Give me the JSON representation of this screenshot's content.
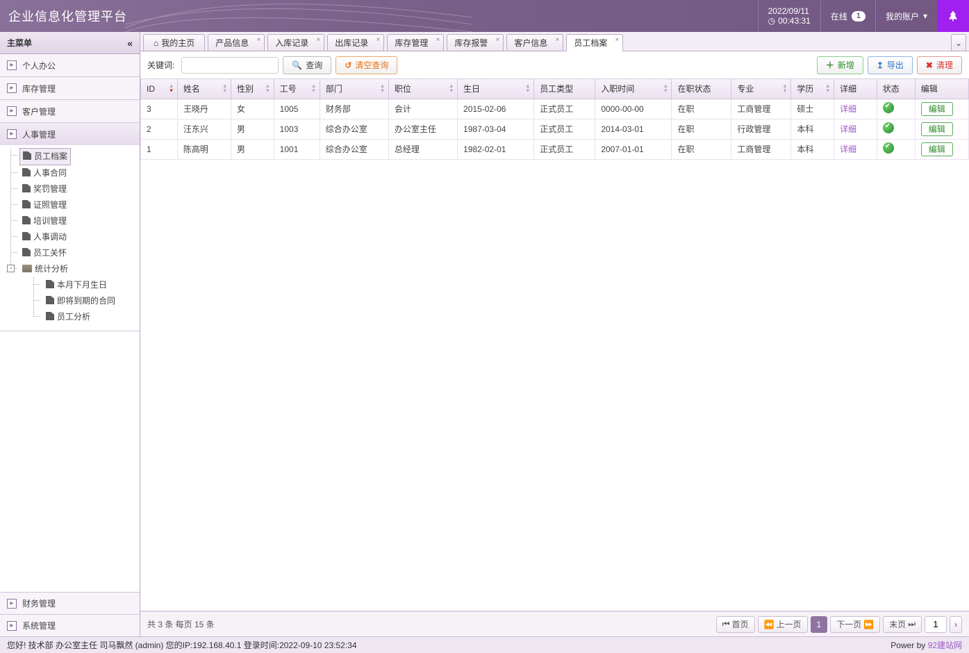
{
  "header": {
    "title": "企业信息化管理平台",
    "date": "2022/09/11",
    "time": "00:43:31",
    "online_label": "在线",
    "online_count": "1",
    "account_label": "我的账户"
  },
  "sidebar": {
    "title": "主菜单",
    "sections": [
      {
        "label": "个人办公"
      },
      {
        "label": "库存管理"
      },
      {
        "label": "客户管理"
      },
      {
        "label": "人事管理"
      }
    ],
    "hr_tree": {
      "items": [
        {
          "label": "员工档案",
          "selected": true
        },
        {
          "label": "人事合同"
        },
        {
          "label": "奖罚管理"
        },
        {
          "label": "证照管理"
        },
        {
          "label": "培训管理"
        },
        {
          "label": "人事调动"
        },
        {
          "label": "员工关怀"
        }
      ],
      "stats_label": "统计分析",
      "stats_children": [
        {
          "label": "本月下月生日"
        },
        {
          "label": "即将到期的合同"
        },
        {
          "label": "员工分析"
        }
      ]
    },
    "bottom_sections": [
      {
        "label": "财务管理"
      },
      {
        "label": "系统管理"
      }
    ]
  },
  "tabs": [
    {
      "label": "我的主页",
      "home": true
    },
    {
      "label": "产品信息"
    },
    {
      "label": "入库记录"
    },
    {
      "label": "出库记录"
    },
    {
      "label": "库存管理"
    },
    {
      "label": "库存报警"
    },
    {
      "label": "客户信息"
    },
    {
      "label": "员工档案",
      "active": true
    }
  ],
  "toolbar": {
    "keyword_label": "关键词:",
    "search": "查询",
    "clear_search": "清空查询",
    "add": "新增",
    "export": "导出",
    "clear": "清理"
  },
  "columns": [
    "ID",
    "姓名",
    "性别",
    "工号",
    "部门",
    "职位",
    "生日",
    "员工类型",
    "入职时间",
    "在职状态",
    "专业",
    "学历",
    "详细",
    "状态",
    "编辑"
  ],
  "detail_link": "详细",
  "edit_label": "编辑",
  "rows": [
    {
      "id": "3",
      "name": "王晓丹",
      "gender": "女",
      "no": "1005",
      "dept": "财务部",
      "pos": "会计",
      "birth": "2015-02-06",
      "type": "正式员工",
      "hire": "0000-00-00",
      "onjob": "在职",
      "major": "工商管理",
      "edu": "硕士"
    },
    {
      "id": "2",
      "name": "汪东兴",
      "gender": "男",
      "no": "1003",
      "dept": "综合办公室",
      "pos": "办公室主任",
      "birth": "1987-03-04",
      "type": "正式员工",
      "hire": "2014-03-01",
      "onjob": "在职",
      "major": "行政管理",
      "edu": "本科"
    },
    {
      "id": "1",
      "name": "陈高明",
      "gender": "男",
      "no": "1001",
      "dept": "综合办公室",
      "pos": "总经理",
      "birth": "1982-02-01",
      "type": "正式员工",
      "hire": "2007-01-01",
      "onjob": "在职",
      "major": "工商管理",
      "edu": "本科"
    }
  ],
  "pager": {
    "info": "共 3 条 每页 15 条",
    "first": "首页",
    "prev": "上一页",
    "current": "1",
    "next": "下一页",
    "last": "末页",
    "goto": "1"
  },
  "footer": {
    "left": "您好! 技术部 办公室主任 司马飘然 (admin) 您的IP:192.168.40.1 登录时间:2022-09-10 23:52:34",
    "powerby": "Power by ",
    "link": "92建站网"
  }
}
